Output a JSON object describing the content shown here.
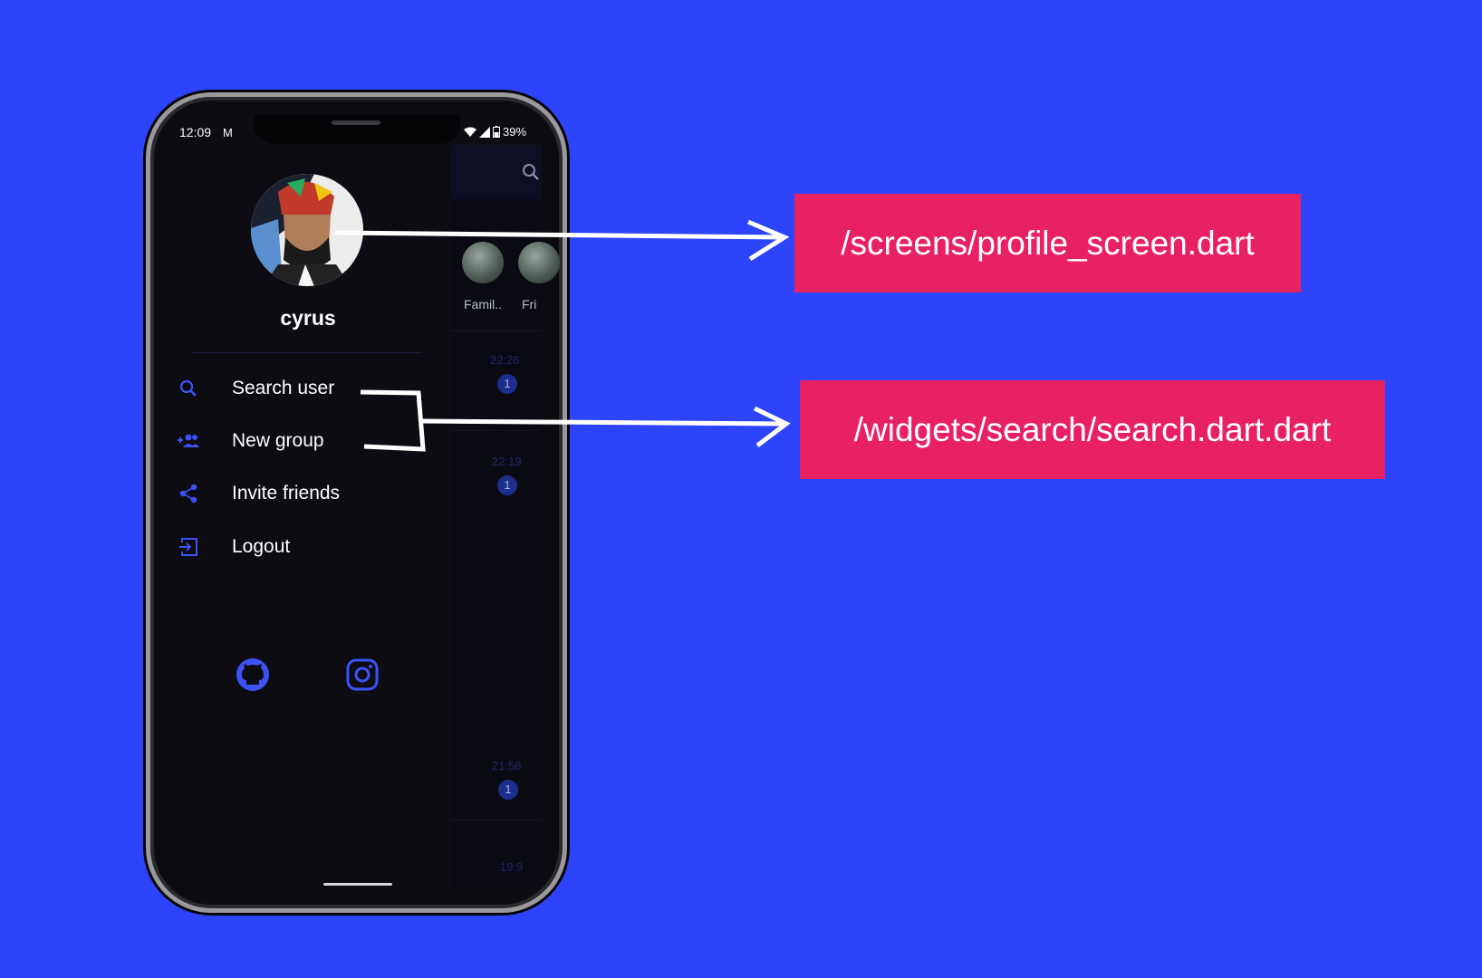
{
  "status_bar": {
    "time": "12:09",
    "battery": "39%"
  },
  "drawer": {
    "username": "cyrus",
    "menu": [
      {
        "label": "Search user",
        "icon": "search-icon"
      },
      {
        "label": "New group",
        "icon": "group-add-icon"
      },
      {
        "label": "Invite friends",
        "icon": "share-icon"
      },
      {
        "label": "Logout",
        "icon": "logout-icon"
      }
    ],
    "social": [
      "github-icon",
      "instagram-icon"
    ]
  },
  "background_list": {
    "stories": [
      "Famil..",
      "Fri"
    ],
    "chats": [
      {
        "time": "22:26",
        "badge": "1"
      },
      {
        "time": "22:19",
        "badge": "1"
      },
      {
        "time": "21:58",
        "badge": "1"
      },
      {
        "time": "19:9"
      }
    ]
  },
  "annotations": {
    "profile": "/screens/profile_screen.dart",
    "search": "/widgets/search/search.dart.dart"
  },
  "colors": {
    "background": "#2d44fb",
    "accent": "#3d52f5",
    "callout": "#e82262"
  }
}
